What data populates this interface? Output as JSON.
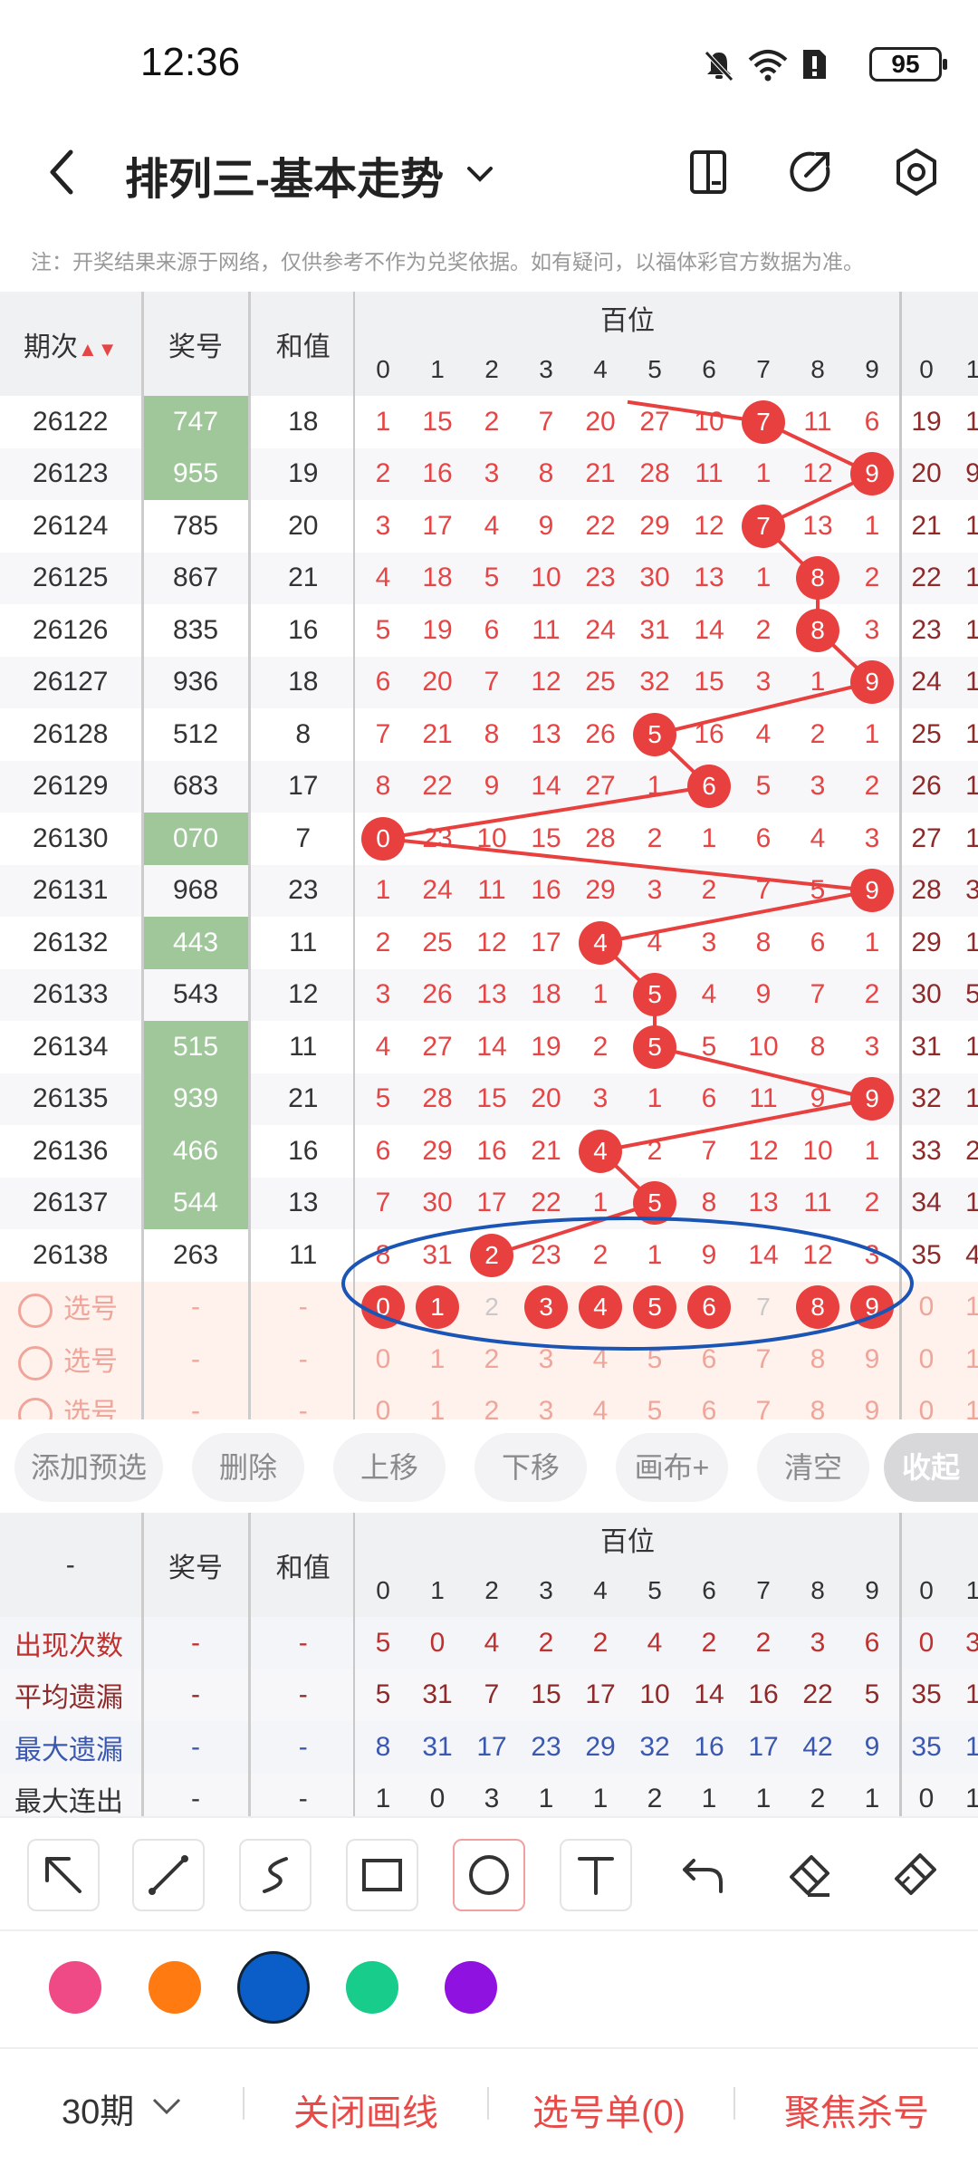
{
  "status": {
    "time": "12:36",
    "battery": "95"
  },
  "header": {
    "title": "排列三-基本走势"
  },
  "note": "注：开奖结果来源于网络，仅供参考不作为兑奖依据。如有疑问，以福体彩官方数据为准。",
  "table": {
    "col_period": "期次",
    "col_award": "奖号",
    "col_sum": "和值",
    "group_hundreds": "百位",
    "digits": [
      "0",
      "1",
      "2",
      "3",
      "4",
      "5",
      "6",
      "7",
      "8",
      "9"
    ],
    "next_group_digits": [
      "0",
      "1"
    ],
    "rows": [
      {
        "period": "26122",
        "award": "747",
        "sum": "18",
        "green": true,
        "cells": [
          "1",
          "15",
          "2",
          "7",
          "20",
          "27",
          "10",
          "7",
          "11",
          "6"
        ],
        "hit": 7,
        "extra": [
          "19",
          "1"
        ]
      },
      {
        "period": "26123",
        "award": "955",
        "sum": "19",
        "green": true,
        "cells": [
          "2",
          "16",
          "3",
          "8",
          "21",
          "28",
          "11",
          "1",
          "12",
          "9"
        ],
        "hit": 9,
        "extra": [
          "20",
          "9"
        ]
      },
      {
        "period": "26124",
        "award": "785",
        "sum": "20",
        "green": false,
        "cells": [
          "3",
          "17",
          "4",
          "9",
          "22",
          "29",
          "12",
          "7",
          "13",
          "1"
        ],
        "hit": 7,
        "extra": [
          "21",
          "1"
        ]
      },
      {
        "period": "26125",
        "award": "867",
        "sum": "21",
        "green": false,
        "cells": [
          "4",
          "18",
          "5",
          "10",
          "23",
          "30",
          "13",
          "1",
          "8",
          "2"
        ],
        "hit": 8,
        "extra": [
          "22",
          "1"
        ]
      },
      {
        "period": "26126",
        "award": "835",
        "sum": "16",
        "green": false,
        "cells": [
          "5",
          "19",
          "6",
          "11",
          "24",
          "31",
          "14",
          "2",
          "8",
          "3"
        ],
        "hit": 8,
        "extra": [
          "23",
          "1"
        ]
      },
      {
        "period": "26127",
        "award": "936",
        "sum": "18",
        "green": false,
        "cells": [
          "6",
          "20",
          "7",
          "12",
          "25",
          "32",
          "15",
          "3",
          "1",
          "9"
        ],
        "hit": 9,
        "extra": [
          "24",
          "1"
        ]
      },
      {
        "period": "26128",
        "award": "512",
        "sum": "8",
        "green": false,
        "cells": [
          "7",
          "21",
          "8",
          "13",
          "26",
          "5",
          "16",
          "4",
          "2",
          "1"
        ],
        "hit": 5,
        "extra": [
          "25",
          "1"
        ]
      },
      {
        "period": "26129",
        "award": "683",
        "sum": "17",
        "green": false,
        "cells": [
          "8",
          "22",
          "9",
          "14",
          "27",
          "1",
          "6",
          "5",
          "3",
          "2"
        ],
        "hit": 6,
        "extra": [
          "26",
          "1"
        ]
      },
      {
        "period": "26130",
        "award": "070",
        "sum": "7",
        "green": true,
        "cells": [
          "0",
          "23",
          "10",
          "15",
          "28",
          "2",
          "1",
          "6",
          "4",
          "3"
        ],
        "hit": 0,
        "extra": [
          "27",
          "1"
        ]
      },
      {
        "period": "26131",
        "award": "968",
        "sum": "23",
        "green": false,
        "cells": [
          "1",
          "24",
          "11",
          "16",
          "29",
          "3",
          "2",
          "7",
          "5",
          "9"
        ],
        "hit": 9,
        "extra": [
          "28",
          "3"
        ]
      },
      {
        "period": "26132",
        "award": "443",
        "sum": "11",
        "green": true,
        "cells": [
          "2",
          "25",
          "12",
          "17",
          "4",
          "4",
          "3",
          "8",
          "6",
          "1"
        ],
        "hit": 4,
        "extra": [
          "29",
          "1"
        ]
      },
      {
        "period": "26133",
        "award": "543",
        "sum": "12",
        "green": false,
        "cells": [
          "3",
          "26",
          "13",
          "18",
          "1",
          "5",
          "4",
          "9",
          "7",
          "2"
        ],
        "hit": 5,
        "extra": [
          "30",
          "5"
        ]
      },
      {
        "period": "26134",
        "award": "515",
        "sum": "11",
        "green": true,
        "cells": [
          "4",
          "27",
          "14",
          "19",
          "2",
          "5",
          "5",
          "10",
          "8",
          "3"
        ],
        "hit": 5,
        "extra": [
          "31",
          "1"
        ]
      },
      {
        "period": "26135",
        "award": "939",
        "sum": "21",
        "green": true,
        "cells": [
          "5",
          "28",
          "15",
          "20",
          "3",
          "1",
          "6",
          "11",
          "9",
          "9"
        ],
        "hit": 9,
        "extra": [
          "32",
          "1"
        ]
      },
      {
        "period": "26136",
        "award": "466",
        "sum": "16",
        "green": true,
        "cells": [
          "6",
          "29",
          "16",
          "21",
          "4",
          "2",
          "7",
          "12",
          "10",
          "1"
        ],
        "hit": 4,
        "extra": [
          "33",
          "2"
        ]
      },
      {
        "period": "26137",
        "award": "544",
        "sum": "13",
        "green": true,
        "cells": [
          "7",
          "30",
          "17",
          "22",
          "1",
          "5",
          "8",
          "13",
          "11",
          "2"
        ],
        "hit": 5,
        "extra": [
          "34",
          "1"
        ]
      },
      {
        "period": "26138",
        "award": "263",
        "sum": "11",
        "green": false,
        "cells": [
          "8",
          "31",
          "2",
          "23",
          "2",
          "1",
          "9",
          "14",
          "12",
          "3"
        ],
        "hit": 2,
        "extra": [
          "35",
          "4"
        ]
      }
    ],
    "pick_label": "选号",
    "dash": "-",
    "pick_selected": [
      "0",
      "1",
      "3",
      "4",
      "5",
      "6",
      "8",
      "9"
    ],
    "pick_unselected": [
      "2",
      "7"
    ]
  },
  "buttons": {
    "add": "添加预选",
    "delete": "删除",
    "up": "上移",
    "down": "下移",
    "canvas": "画布+",
    "clear": "清空",
    "collapse": "收起"
  },
  "stats": {
    "col_dash": "-",
    "col_award": "奖号",
    "col_sum": "和值",
    "group_hundreds": "百位",
    "rows": [
      {
        "label": "出现次数",
        "color": "#c0302e",
        "values": [
          "5",
          "0",
          "4",
          "2",
          "2",
          "4",
          "2",
          "2",
          "3",
          "6"
        ],
        "extra": [
          "0",
          "3"
        ]
      },
      {
        "label": "平均遗漏",
        "color": "#8e2a2a",
        "values": [
          "5",
          "31",
          "7",
          "15",
          "17",
          "10",
          "14",
          "16",
          "22",
          "5"
        ],
        "extra": [
          "35",
          "1"
        ]
      },
      {
        "label": "最大遗漏",
        "color": "#3a58b0",
        "values": [
          "8",
          "31",
          "17",
          "23",
          "29",
          "32",
          "16",
          "17",
          "42",
          "9"
        ],
        "extra": [
          "35",
          "1"
        ]
      },
      {
        "label": "最大连出",
        "color": "#333333",
        "values": [
          "1",
          "0",
          "3",
          "1",
          "1",
          "2",
          "1",
          "1",
          "2",
          "1"
        ],
        "extra": [
          "0",
          "1"
        ]
      }
    ]
  },
  "colors": {
    "swatches": [
      "#ef4a86",
      "#ff7a10",
      "#0b5ec8",
      "#18cc8c",
      "#8f12e0"
    ],
    "accent": "#e84a48",
    "ball": "#e8403e",
    "highlight_ellipse": "#1a55b5"
  },
  "bottom": {
    "period_select": "30期",
    "close_draw": "关闭画线",
    "pick_list": "选号单(0)",
    "focus_kill": "聚焦杀号"
  }
}
